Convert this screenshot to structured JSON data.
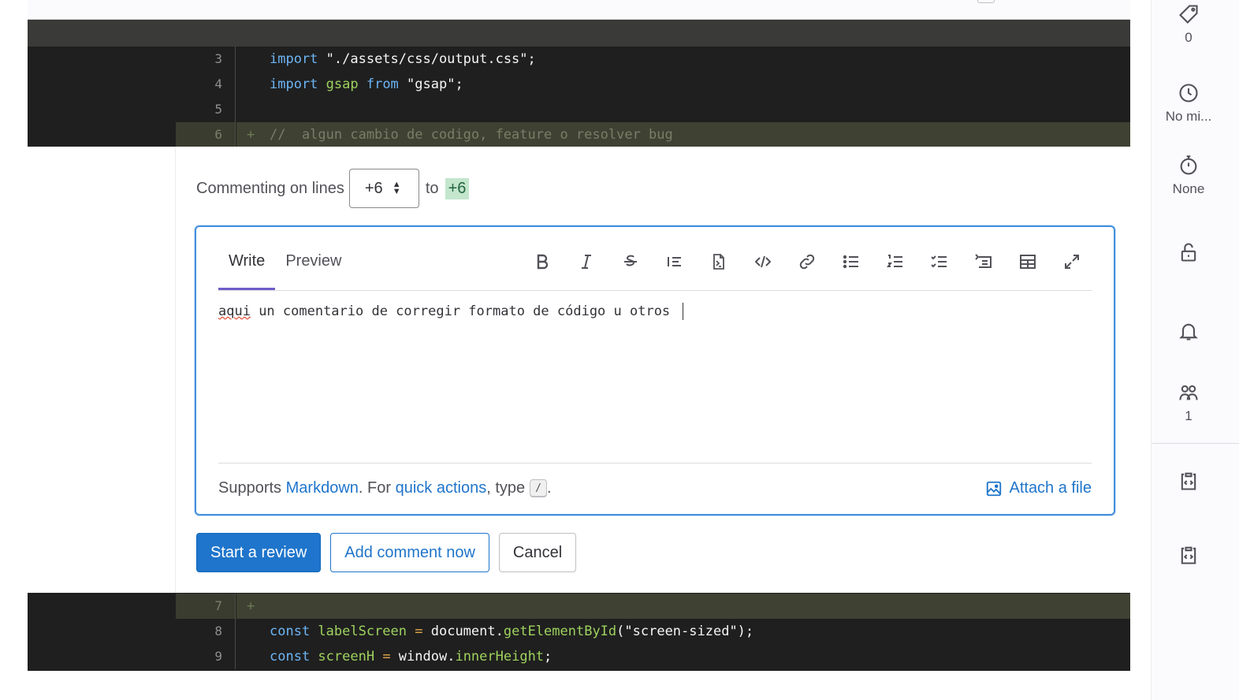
{
  "diff": {
    "top_lines": [
      {
        "num": "3",
        "prefix": "",
        "tokens": [
          {
            "t": "import",
            "c": "kw"
          },
          {
            "t": " \"./assets/css/output.css\";",
            "c": "str"
          }
        ]
      },
      {
        "num": "4",
        "prefix": "",
        "tokens": [
          {
            "t": "import",
            "c": "kw"
          },
          {
            "t": " gsap ",
            "c": "ident"
          },
          {
            "t": "from",
            "c": "kw"
          },
          {
            "t": " \"gsap\";",
            "c": "str"
          }
        ]
      },
      {
        "num": "5",
        "prefix": "",
        "tokens": []
      },
      {
        "num": "6",
        "prefix": "+",
        "tokens": [
          {
            "t": "//  algun cambio de codigo, feature o resolver bug",
            "c": ""
          }
        ]
      }
    ],
    "bottom_lines": [
      {
        "num": "7",
        "prefix": "+",
        "tokens": []
      },
      {
        "num": "8",
        "prefix": "",
        "tokens": [
          {
            "t": "const",
            "c": "kw"
          },
          {
            "t": " labelScreen ",
            "c": "ident"
          },
          {
            "t": "=",
            "c": "op"
          },
          {
            "t": " document.",
            "c": "str"
          },
          {
            "t": "getElementById",
            "c": "fn"
          },
          {
            "t": "(\"screen-sized\");",
            "c": "str"
          }
        ]
      },
      {
        "num": "9",
        "prefix": "",
        "tokens": [
          {
            "t": "const",
            "c": "kw"
          },
          {
            "t": " screenH ",
            "c": "ident"
          },
          {
            "t": "=",
            "c": "op"
          },
          {
            "t": " window.",
            "c": "str"
          },
          {
            "t": "innerHeight",
            "c": "fn"
          },
          {
            "t": ";",
            "c": "str"
          }
        ]
      }
    ]
  },
  "comment_form": {
    "lines_label": "Commenting on lines",
    "start_line": "+6",
    "to_label": "to",
    "end_line": "+6",
    "tabs": {
      "write": "Write",
      "preview": "Preview"
    },
    "toolbar_icons": [
      "bold-icon",
      "italic-icon",
      "strikethrough-icon",
      "quote-icon",
      "suggestion-icon",
      "code-icon",
      "link-icon",
      "bullet-list-icon",
      "numbered-list-icon",
      "task-list-icon",
      "collapsible-icon",
      "table-icon",
      "fullscreen-icon"
    ],
    "text_misspelled": "aqui",
    "text_rest": " un comentario de corregir formato de código u otros ",
    "help": {
      "supports": "Supports",
      "markdown": "Markdown",
      "for": ". For",
      "quick_actions": "quick actions",
      "type": ", type",
      "slash": "/",
      "dot": "."
    },
    "attach_label": "Attach a file",
    "buttons": {
      "start_review": "Start a review",
      "add_comment": "Add comment now",
      "cancel": "Cancel"
    }
  },
  "sidebar": {
    "labels_count": "0",
    "milestone": "No mi...",
    "time_tracking": "None",
    "participants_count": "1",
    "icons": [
      "label-icon",
      "clock-icon",
      "timer-icon",
      "lock-open-icon",
      "bell-icon",
      "users-icon",
      "copy-reference-icon",
      "copy-email-icon"
    ]
  },
  "colors": {
    "accent": "#1f75cb",
    "active_tab": "#6f5ec8",
    "added_line": "#3f4132",
    "focus_border": "#428fdc"
  }
}
